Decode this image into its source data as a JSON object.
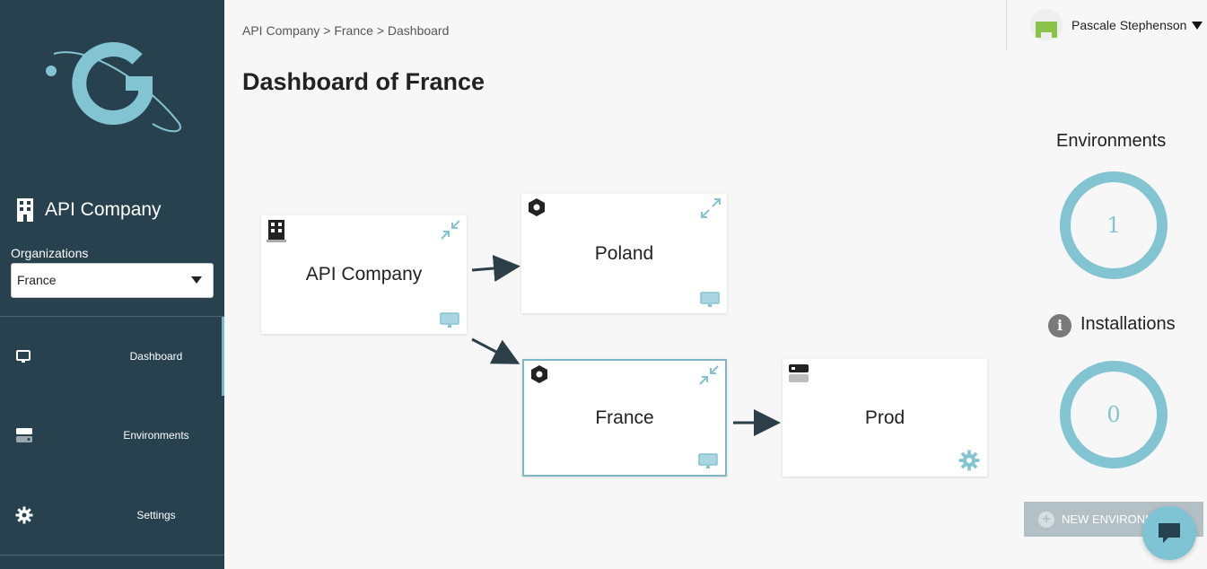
{
  "sidebar": {
    "company_name": "API Company",
    "organizations_label": "Organizations",
    "organization_selected": "France",
    "nav": [
      {
        "label": "Dashboard",
        "icon": "monitor-icon",
        "active": true
      },
      {
        "label": "Environments",
        "icon": "server-icon",
        "active": false
      },
      {
        "label": "Settings",
        "icon": "gear-icon",
        "active": false
      }
    ]
  },
  "header": {
    "breadcrumb": [
      "API Company",
      "France",
      "Dashboard"
    ],
    "breadcrumb_separator": ">",
    "title": "Dashboard of France"
  },
  "user": {
    "name": "Pascale Stephenson"
  },
  "diagram": {
    "nodes": [
      {
        "label": "API Company",
        "type": "company"
      },
      {
        "label": "Poland",
        "type": "organization"
      },
      {
        "label": "France",
        "type": "organization",
        "selected": true
      },
      {
        "label": "Prod",
        "type": "environment"
      }
    ]
  },
  "stats": {
    "environments_title": "Environments",
    "environments_count": "1",
    "installations_title": "Installations",
    "installations_count": "0"
  },
  "actions": {
    "new_environment_label": "NEW ENVIRONMENT"
  },
  "colors": {
    "sidebar_bg": "#27414e",
    "accent": "#83c4d3",
    "button_disabled": "#b3c1c7"
  }
}
